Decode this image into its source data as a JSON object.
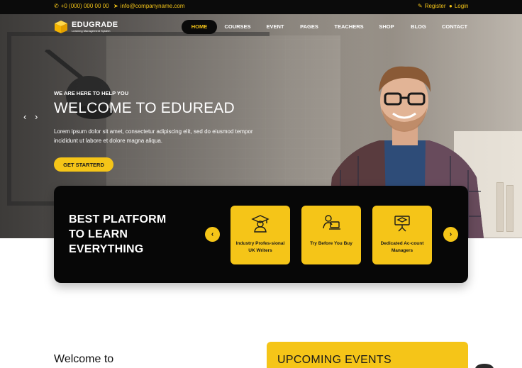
{
  "topbar": {
    "phone": "+0 (000) 000 00 00",
    "email": "info@companyname.com",
    "register": "Register",
    "login": "Login"
  },
  "brand": {
    "name": "EDUGRADE",
    "tagline": "Learning Management System"
  },
  "nav": {
    "items": [
      {
        "label": "HOME",
        "active": true
      },
      {
        "label": "COURSES"
      },
      {
        "label": "EVENT"
      },
      {
        "label": "PAGES"
      },
      {
        "label": "TEACHERS"
      },
      {
        "label": "SHOP"
      },
      {
        "label": "BLOG"
      },
      {
        "label": "CONTACT"
      }
    ]
  },
  "hero": {
    "eyebrow": "WE ARE HERE TO HELP YOU",
    "title": "WELCOME TO EDUREAD",
    "subtitle": "Lorem ipsum dolor sit amet, consectetur adipiscing elit, sed do eiusmod tempor incididunt ut labore et dolore magna aliqua.",
    "cta": "GET STARTERD",
    "prev_arrow": "‹",
    "next_arrow": "›"
  },
  "panel": {
    "title": "BEST PLATFORM TO LEARN EVERYTHING",
    "prev": "‹",
    "next": "›",
    "cards": [
      {
        "label": "Industry Profes-sional UK Writers",
        "icon": "graduate-icon"
      },
      {
        "label": "Try Before You Buy",
        "icon": "laptop-user-icon"
      },
      {
        "label": "Dedicated Ac-count Managers",
        "icon": "presentation-icon"
      }
    ]
  },
  "lower": {
    "welcome": "Welcome to",
    "events_title": "UPCOMING EVENTS"
  },
  "colors": {
    "accent": "#f5c518",
    "dark": "#070707"
  }
}
